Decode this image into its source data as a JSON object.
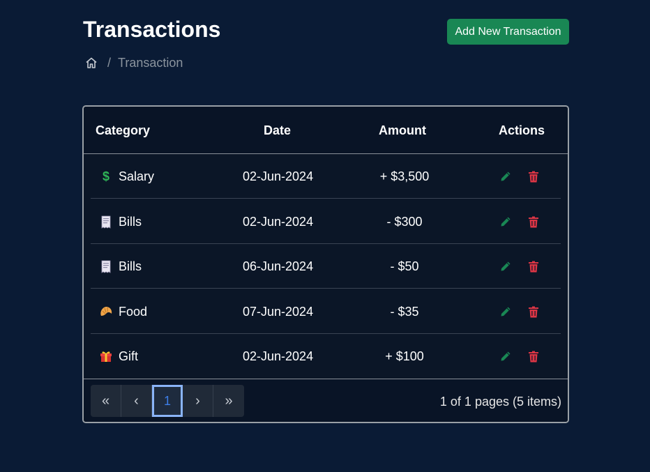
{
  "header": {
    "title": "Transactions",
    "add_button": "Add New Transaction"
  },
  "breadcrumb": {
    "home_icon": "home-icon",
    "separator": "/",
    "current": "Transaction"
  },
  "table": {
    "columns": [
      "Category",
      "Date",
      "Amount",
      "Actions"
    ],
    "rows": [
      {
        "icon": "dollar-icon",
        "emoji": "$",
        "category": "Salary",
        "date": "02-Jun-2024",
        "amount": "+ $3,500"
      },
      {
        "icon": "receipt-icon",
        "emoji": "🧾",
        "category": "Bills",
        "date": "02-Jun-2024",
        "amount": "- $300"
      },
      {
        "icon": "receipt-icon",
        "emoji": "🧾",
        "category": "Bills",
        "date": "06-Jun-2024",
        "amount": "- $50"
      },
      {
        "icon": "croissant-icon",
        "emoji": "🥐",
        "category": "Food",
        "date": "07-Jun-2024",
        "amount": "- $35"
      },
      {
        "icon": "gift-icon",
        "emoji": "🎁",
        "category": "Gift",
        "date": "02-Jun-2024",
        "amount": "+ $100"
      }
    ]
  },
  "pagination": {
    "first": "«",
    "prev": "‹",
    "current_page": "1",
    "next": "›",
    "last": "»",
    "info": "1 of 1 pages (5 items)"
  },
  "colors": {
    "background": "#0a1b35",
    "accent": "#198754",
    "delete": "#dc3545",
    "edit": "#198754"
  }
}
